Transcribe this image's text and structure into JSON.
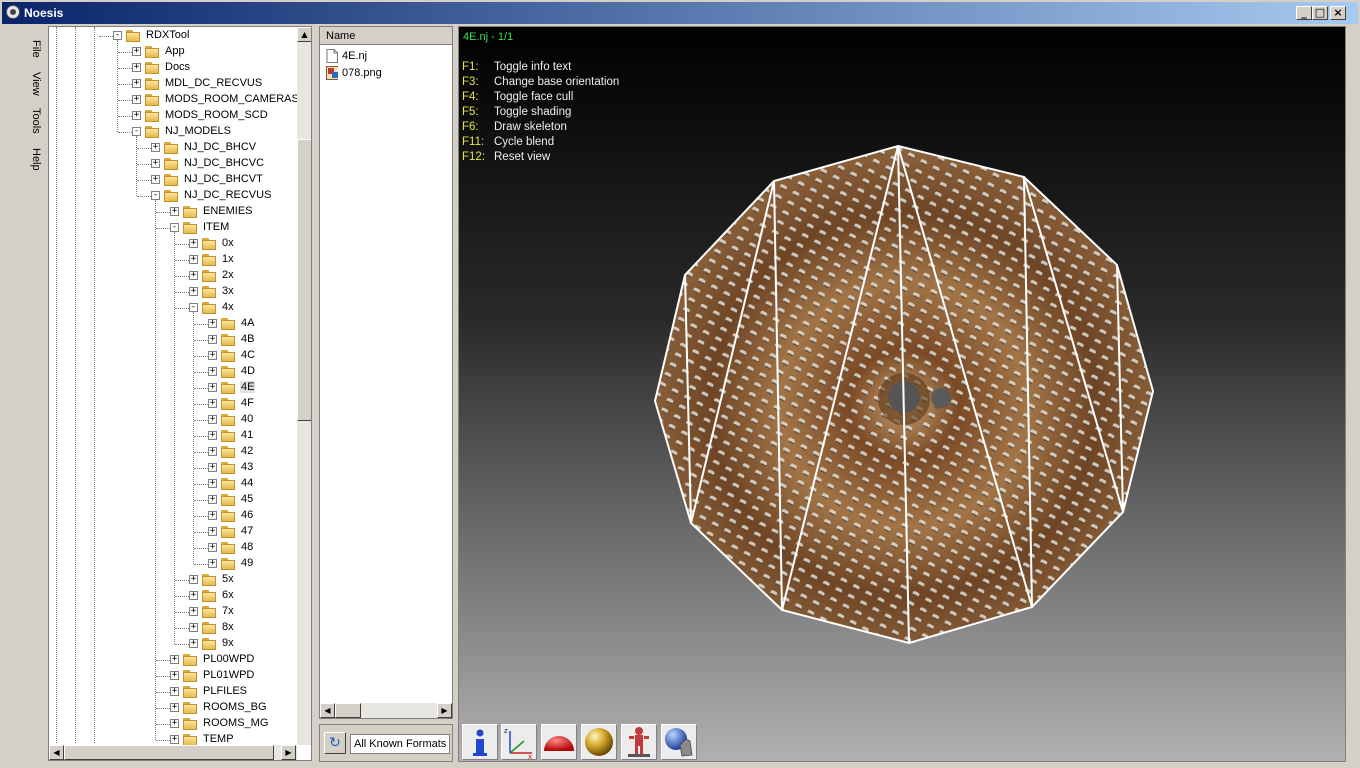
{
  "window": {
    "title": "Noesis",
    "minimize_glyph": "_",
    "maximize_glyph": "□",
    "close_glyph": "×"
  },
  "menu": {
    "items": [
      "File",
      "View",
      "Tools",
      "Help"
    ]
  },
  "tree": {
    "rows": [
      {
        "label": "RDXTool",
        "expander": "-",
        "depth": 0,
        "selected": false
      },
      {
        "label": "App",
        "expander": "+",
        "depth": 1,
        "selected": false
      },
      {
        "label": "Docs",
        "expander": "+",
        "depth": 1,
        "selected": false
      },
      {
        "label": "MDL_DC_RECVUS",
        "expander": "+",
        "depth": 1,
        "selected": false
      },
      {
        "label": "MODS_ROOM_CAMERAS",
        "expander": "+",
        "depth": 1,
        "selected": false
      },
      {
        "label": "MODS_ROOM_SCD",
        "expander": "+",
        "depth": 1,
        "selected": false
      },
      {
        "label": "NJ_MODELS",
        "expander": "-",
        "depth": 1,
        "selected": false
      },
      {
        "label": "NJ_DC_BHCV",
        "expander": "+",
        "depth": 2,
        "selected": false
      },
      {
        "label": "NJ_DC_BHCVC",
        "expander": "+",
        "depth": 2,
        "selected": false
      },
      {
        "label": "NJ_DC_BHCVT",
        "expander": "+",
        "depth": 2,
        "selected": false
      },
      {
        "label": "NJ_DC_RECVUS",
        "expander": "-",
        "depth": 2,
        "selected": false
      },
      {
        "label": "ENEMIES",
        "expander": "+",
        "depth": 3,
        "selected": false
      },
      {
        "label": "ITEM",
        "expander": "-",
        "depth": 3,
        "selected": false
      },
      {
        "label": "0x",
        "expander": "+",
        "depth": 4,
        "selected": false
      },
      {
        "label": "1x",
        "expander": "+",
        "depth": 4,
        "selected": false
      },
      {
        "label": "2x",
        "expander": "+",
        "depth": 4,
        "selected": false
      },
      {
        "label": "3x",
        "expander": "+",
        "depth": 4,
        "selected": false
      },
      {
        "label": "4x",
        "expander": "-",
        "depth": 4,
        "selected": false
      },
      {
        "label": "4A",
        "expander": "+",
        "depth": 5,
        "selected": false
      },
      {
        "label": "4B",
        "expander": "+",
        "depth": 5,
        "selected": false
      },
      {
        "label": "4C",
        "expander": "+",
        "depth": 5,
        "selected": false
      },
      {
        "label": "4D",
        "expander": "+",
        "depth": 5,
        "selected": false
      },
      {
        "label": "4E",
        "expander": "+",
        "depth": 5,
        "selected": true
      },
      {
        "label": "4F",
        "expander": "+",
        "depth": 5,
        "selected": false
      },
      {
        "label": "40",
        "expander": "+",
        "depth": 5,
        "selected": false
      },
      {
        "label": "41",
        "expander": "+",
        "depth": 5,
        "selected": false
      },
      {
        "label": "42",
        "expander": "+",
        "depth": 5,
        "selected": false
      },
      {
        "label": "43",
        "expander": "+",
        "depth": 5,
        "selected": false
      },
      {
        "label": "44",
        "expander": "+",
        "depth": 5,
        "selected": false
      },
      {
        "label": "45",
        "expander": "+",
        "depth": 5,
        "selected": false
      },
      {
        "label": "46",
        "expander": "+",
        "depth": 5,
        "selected": false
      },
      {
        "label": "47",
        "expander": "+",
        "depth": 5,
        "selected": false
      },
      {
        "label": "48",
        "expander": "+",
        "depth": 5,
        "selected": false
      },
      {
        "label": "49",
        "expander": "+",
        "depth": 5,
        "selected": false
      },
      {
        "label": "5x",
        "expander": "+",
        "depth": 4,
        "selected": false
      },
      {
        "label": "6x",
        "expander": "+",
        "depth": 4,
        "selected": false
      },
      {
        "label": "7x",
        "expander": "+",
        "depth": 4,
        "selected": false
      },
      {
        "label": "8x",
        "expander": "+",
        "depth": 4,
        "selected": false
      },
      {
        "label": "9x",
        "expander": "+",
        "depth": 4,
        "selected": false
      },
      {
        "label": "PL00WPD",
        "expander": "+",
        "depth": 3,
        "selected": false
      },
      {
        "label": "PL01WPD",
        "expander": "+",
        "depth": 3,
        "selected": false
      },
      {
        "label": "PLFILES",
        "expander": "+",
        "depth": 3,
        "selected": false
      },
      {
        "label": "ROOMS_BG",
        "expander": "+",
        "depth": 3,
        "selected": false
      },
      {
        "label": "ROOMS_MG",
        "expander": "+",
        "depth": 3,
        "selected": false
      },
      {
        "label": "TEMP",
        "expander": "+",
        "depth": 3,
        "selected": false
      }
    ]
  },
  "file_list": {
    "column_header": "Name",
    "files": [
      {
        "name": "4E.nj",
        "icon": "document-icon"
      },
      {
        "name": "078.png",
        "icon": "image-file-icon"
      }
    ]
  },
  "filter": {
    "refresh_glyph": "↻",
    "format": "All Known Formats"
  },
  "viewport": {
    "model_title": "4E.nj - 1/1",
    "hotkeys": [
      {
        "key": "F1:",
        "desc": "Toggle info text"
      },
      {
        "key": "F3:",
        "desc": "Change base orientation"
      },
      {
        "key": "F4:",
        "desc": "Toggle face cull"
      },
      {
        "key": "F5:",
        "desc": "Toggle shading"
      },
      {
        "key": "F6:",
        "desc": "Draw skeleton"
      },
      {
        "key": "F11:",
        "desc": "Cycle blend"
      },
      {
        "key": "F12:",
        "desc": "Reset view"
      }
    ],
    "toolbar": [
      {
        "name": "info-tool",
        "icon": "info-icon"
      },
      {
        "name": "axes-tool",
        "icon": "axes-icon"
      },
      {
        "name": "hemisphere-tool",
        "icon": "red-hemisphere-icon"
      },
      {
        "name": "sphere-tool",
        "icon": "gold-sphere-icon"
      },
      {
        "name": "skeleton-tool",
        "icon": "figure-icon"
      },
      {
        "name": "lighting-tool",
        "icon": "globe-hand-icon"
      }
    ],
    "colors": {
      "title": "#3fe04a",
      "hotkey": "#e5e549",
      "description": "#f0f0f0"
    }
  }
}
